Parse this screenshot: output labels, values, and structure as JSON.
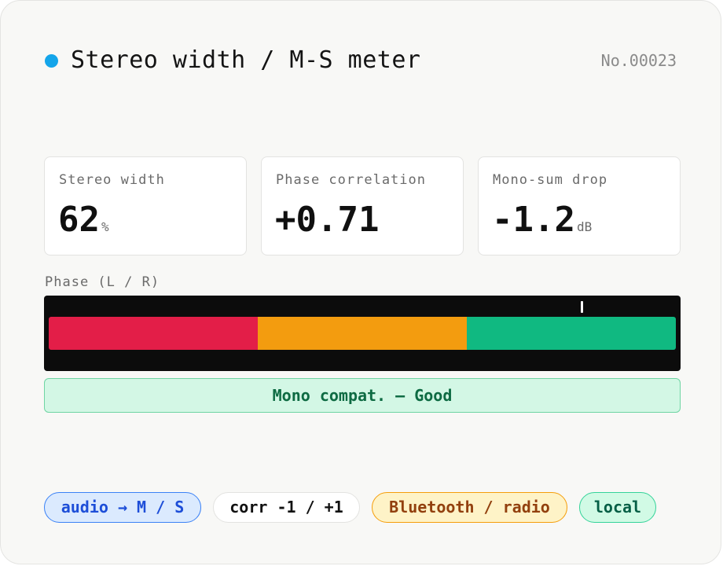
{
  "header": {
    "title": "Stereo width / M-S meter",
    "serial": "No.00023",
    "dot_color": "#14a5ea"
  },
  "metrics": [
    {
      "label": "Stereo width",
      "value": "62",
      "unit": "%"
    },
    {
      "label": "Phase correlation",
      "value": "+0.71",
      "unit": ""
    },
    {
      "label": "Mono-sum drop",
      "value": "-1.2",
      "unit": "dB"
    }
  ],
  "phase": {
    "label": "Phase (L / R)",
    "segments": [
      {
        "name": "bad",
        "color": "#e31e48",
        "fraction": 0.3333
      },
      {
        "name": "warn",
        "color": "#f39c0f",
        "fraction": 0.3333
      },
      {
        "name": "good",
        "color": "#10b981",
        "fraction": 0.3334
      }
    ],
    "marker_position": 0.845
  },
  "compat": {
    "text": "Mono compat. — Good"
  },
  "chips": [
    {
      "label": "audio → M / S",
      "bg": "#dbeafe",
      "border": "#3b82f6",
      "color": "#1d4ed8"
    },
    {
      "label": "corr -1 / +1",
      "bg": "#ffffff",
      "border": "#e3e3e1",
      "color": "#111111"
    },
    {
      "label": "Bluetooth / radio",
      "bg": "#fef3c7",
      "border": "#f59e0b",
      "color": "#92400e"
    },
    {
      "label": "local",
      "bg": "#d1fae5",
      "border": "#34d399",
      "color": "#065f46"
    }
  ]
}
